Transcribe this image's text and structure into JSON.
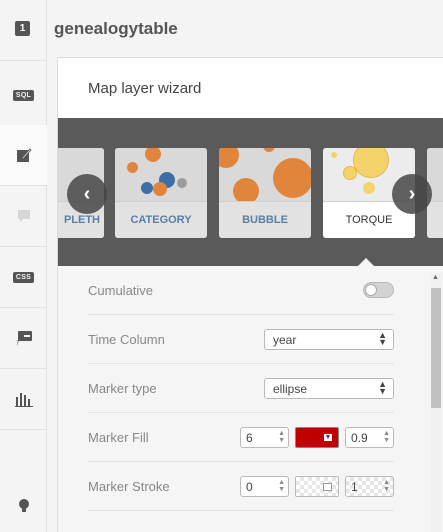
{
  "header": {
    "step": "1",
    "title": "genealogytable"
  },
  "toolbar": {
    "sql_label": "SQL",
    "css_label": "CSS"
  },
  "wizard": {
    "title": "Map layer wizard",
    "cards": [
      {
        "label": "PLETH",
        "selected": false
      },
      {
        "label": "CATEGORY",
        "selected": false
      },
      {
        "label": "BUBBLE",
        "selected": false
      },
      {
        "label": "TORQUE",
        "selected": true
      }
    ],
    "prev_icon": "‹",
    "next_icon": "›"
  },
  "form": {
    "cumulative": {
      "label": "Cumulative",
      "enabled": false
    },
    "time_column": {
      "label": "Time Column",
      "value": "year"
    },
    "marker_type": {
      "label": "Marker type",
      "value": "ellipse"
    },
    "marker_fill": {
      "label": "Marker Fill",
      "size": "6",
      "color": "#c00000",
      "opacity": "0.9"
    },
    "marker_stroke": {
      "label": "Marker Stroke",
      "width": "0",
      "opacity": "1"
    }
  },
  "icons": {
    "sql": "sql-tag-icon",
    "style": "paintbrush-icon",
    "infowindow": "speech-bubble-icon",
    "css": "css-tag-icon",
    "legend": "legend-icon",
    "widgets": "bar-chart-icon",
    "more": "lightbulb-icon"
  }
}
